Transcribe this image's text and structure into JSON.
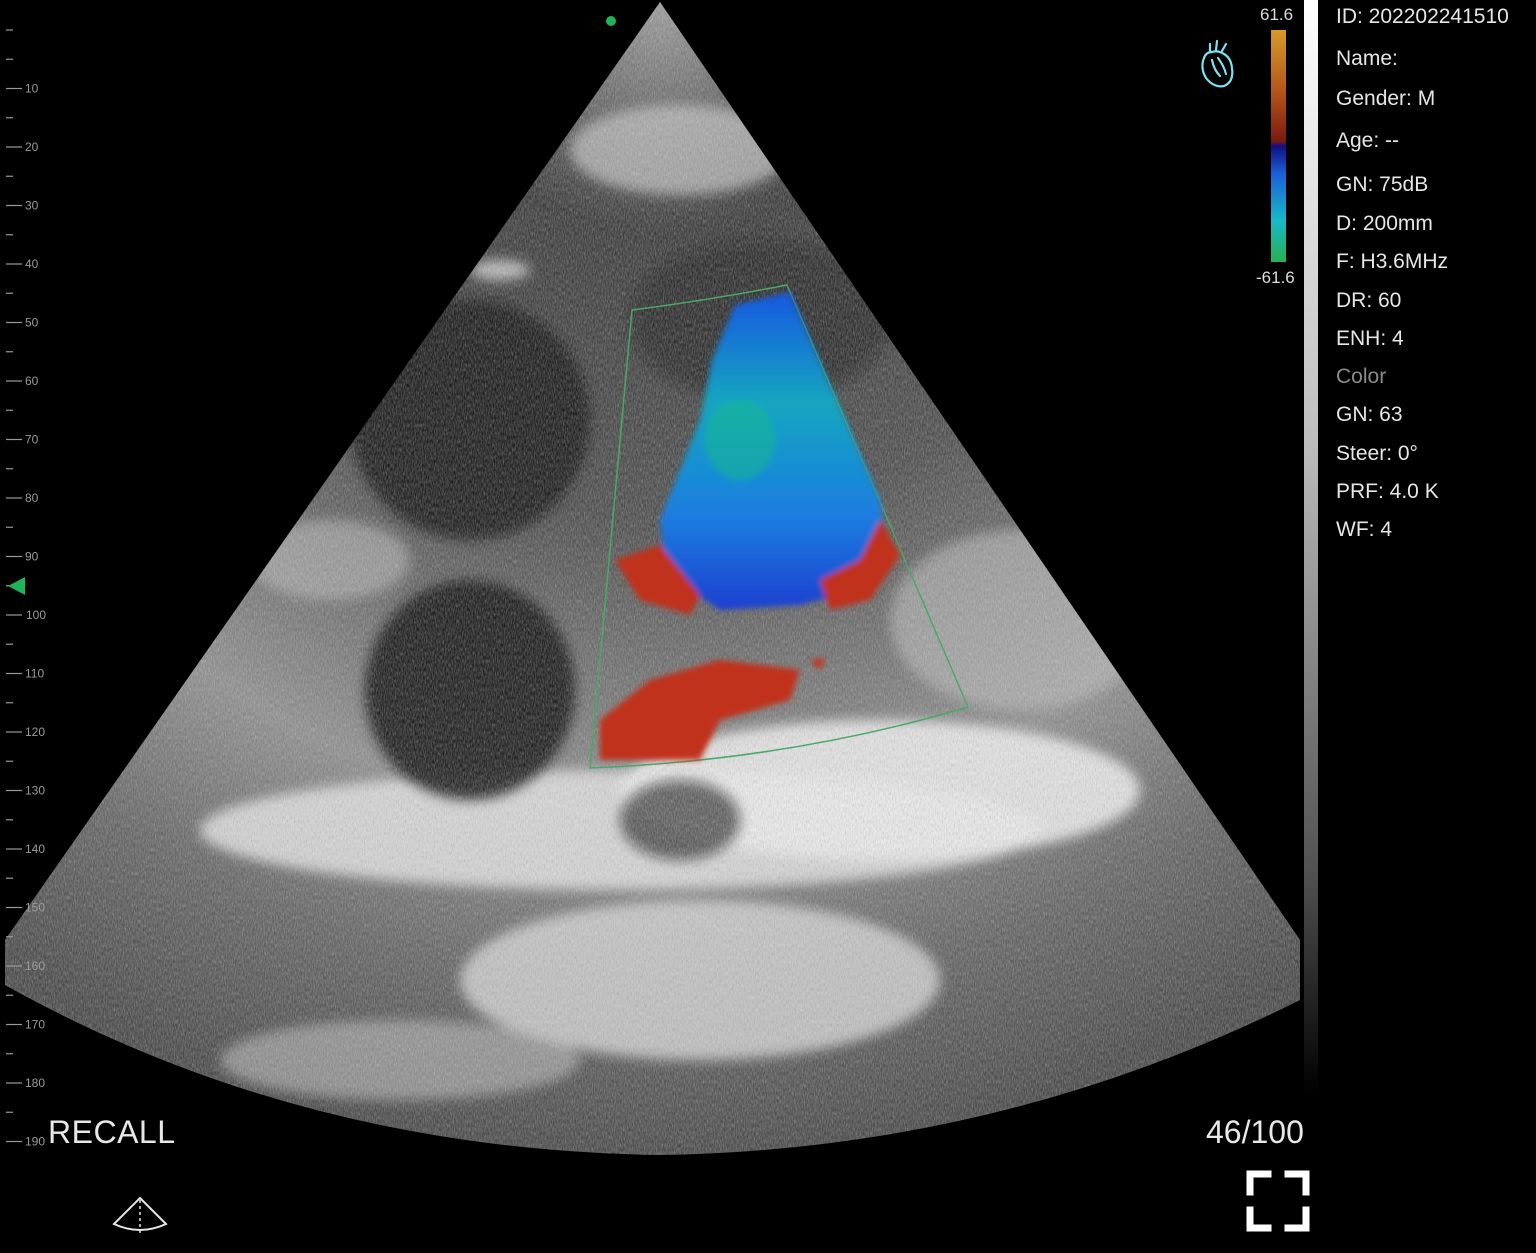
{
  "colorbar": {
    "max_label": "61.6",
    "min_label": "-61.6"
  },
  "depth_scale": {
    "labels": [
      "10",
      "20",
      "30",
      "40",
      "50",
      "60",
      "70",
      "80",
      "90",
      "100",
      "110",
      "120",
      "130",
      "140",
      "150",
      "160",
      "170",
      "180",
      "190"
    ]
  },
  "info_panel": {
    "id": "ID: 202202241510",
    "name": "Name:",
    "gender": "Gender: M",
    "age": "Age: --",
    "gain": "GN: 75dB",
    "depth": "D: 200mm",
    "frequency": "F: H3.6MHz",
    "dynamic_range": "DR: 60",
    "enhancement": "ENH: 4",
    "color_section": "Color",
    "color_gain": "GN: 63",
    "steer": "Steer: 0°",
    "prf": "PRF: 4.0 K",
    "wall_filter": "WF: 4"
  },
  "status": {
    "recall": "RECALL",
    "frame_counter": "46/100"
  },
  "icons": {
    "heart": "heart-preset-icon",
    "probe": "probe-sector-icon",
    "fullscreen": "fullscreen-icon",
    "focus": "focus-marker-icon",
    "orientation": "orientation-dot-icon"
  },
  "colors": {
    "accent_green": "#1fb35a",
    "heart_icon": "#7fe0f0",
    "text": "#e6e6e6",
    "dim_text": "#8a8a8a"
  }
}
